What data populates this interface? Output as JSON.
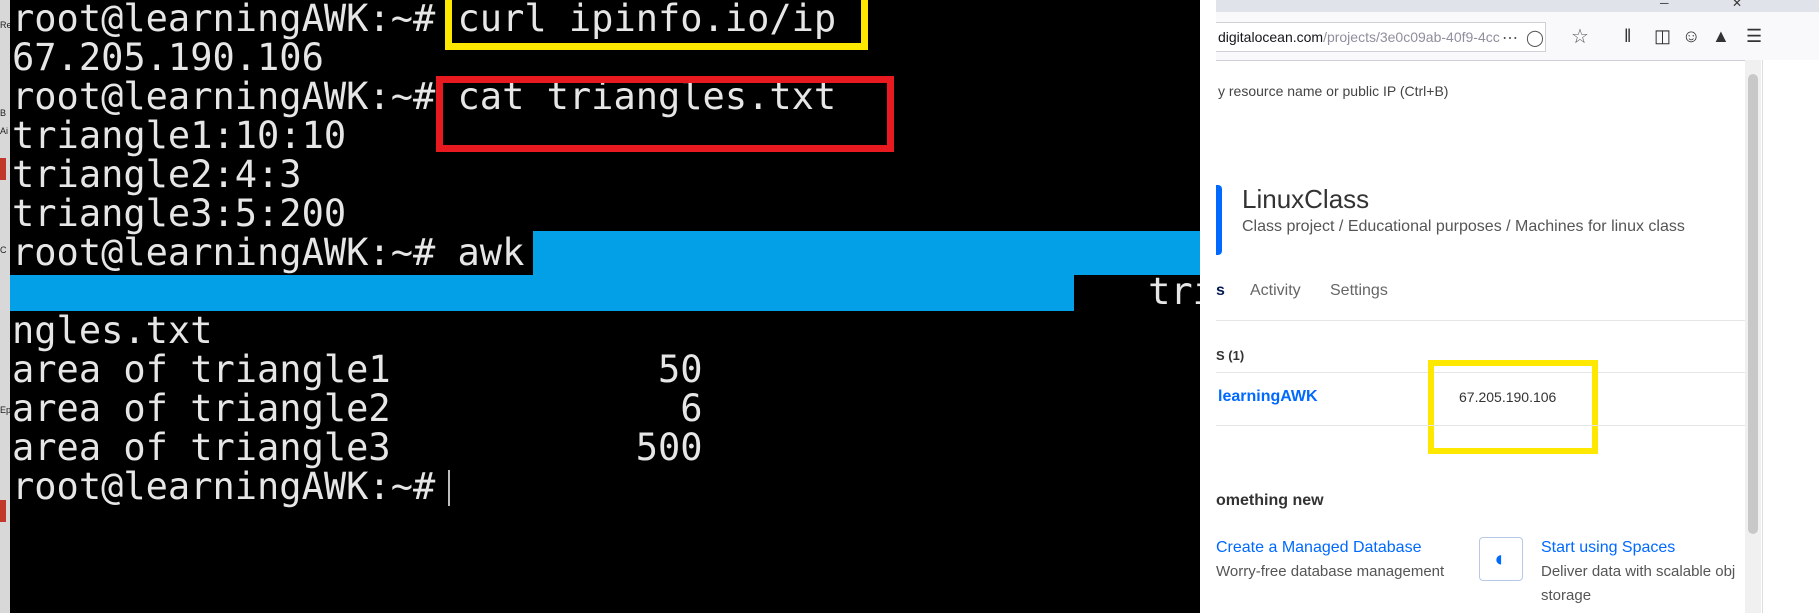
{
  "terminal": {
    "lines": [
      "root@learningAWK:~# curl ipinfo.io/ip",
      "67.205.190.106",
      "root@learningAWK:~# cat triangles.txt",
      "triangle1:10:10",
      "triangle2:4:3",
      "triangle3:5:200",
      "root@learningAWK:~# awk",
      "                                                   tria",
      "ngles.txt",
      "area of triangle1            50",
      "area of triangle2             6",
      "area of triangle3           500",
      "root@learningAWK:~# "
    ]
  },
  "browser": {
    "url_main": "digitalocean.com",
    "url_path": "/projects/3e0c09ab-40f9-4cc",
    "search_hint": "y resource name or public IP (Ctrl+B)",
    "project_title": "LinuxClass",
    "project_subtitle": "Class project / Educational purposes / Machines for linux class",
    "tabs": [
      "s",
      "Activity",
      "Settings"
    ],
    "section_count": "S (1)",
    "resource_name": "learningAWK",
    "resource_ip": "67.205.190.106",
    "something_new": "omething new",
    "card1_title": "Create a Managed Database",
    "card1_desc": "Worry-free database management",
    "card2_title": "Start using Spaces",
    "card2_desc_line1": "Deliver data with scalable obj",
    "card2_desc_line2": "storage"
  },
  "desktop": {
    "labels": [
      "Re",
      "B",
      "Ai",
      "E",
      "C",
      "E",
      "Ep",
      "L"
    ]
  },
  "colors": {
    "yellow_highlight": "#ffe800",
    "red_highlight": "#e8191f",
    "blue_redaction": "#03a0e8",
    "do_blue": "#0069ff"
  }
}
